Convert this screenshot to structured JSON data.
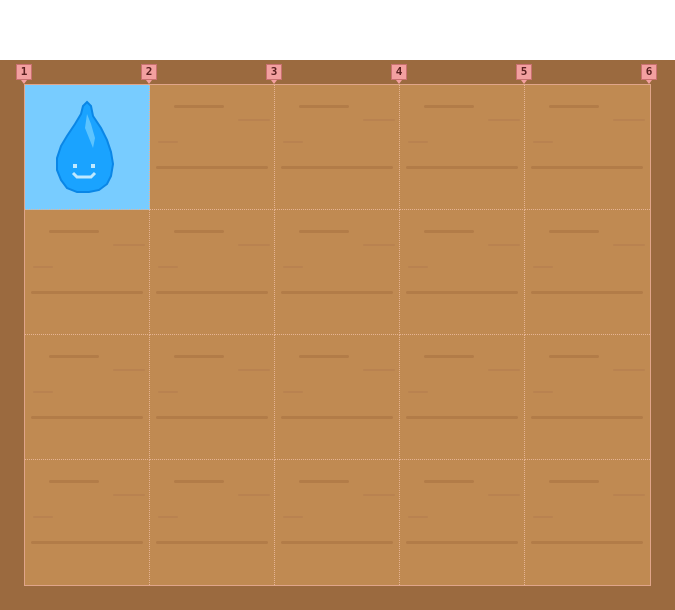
{
  "board": {
    "columns": 5,
    "rows": 4,
    "column_markers": [
      "1",
      "2",
      "3",
      "4",
      "5",
      "6"
    ],
    "player": {
      "row": 1,
      "column": 1,
      "sprite": "water-drop-icon"
    },
    "colors": {
      "frame": "#9b6a3f",
      "tile": "#c08a52",
      "active_tile": "#78ccff",
      "drop": "#1aa3ff",
      "marker": "#f3a0a0"
    }
  }
}
